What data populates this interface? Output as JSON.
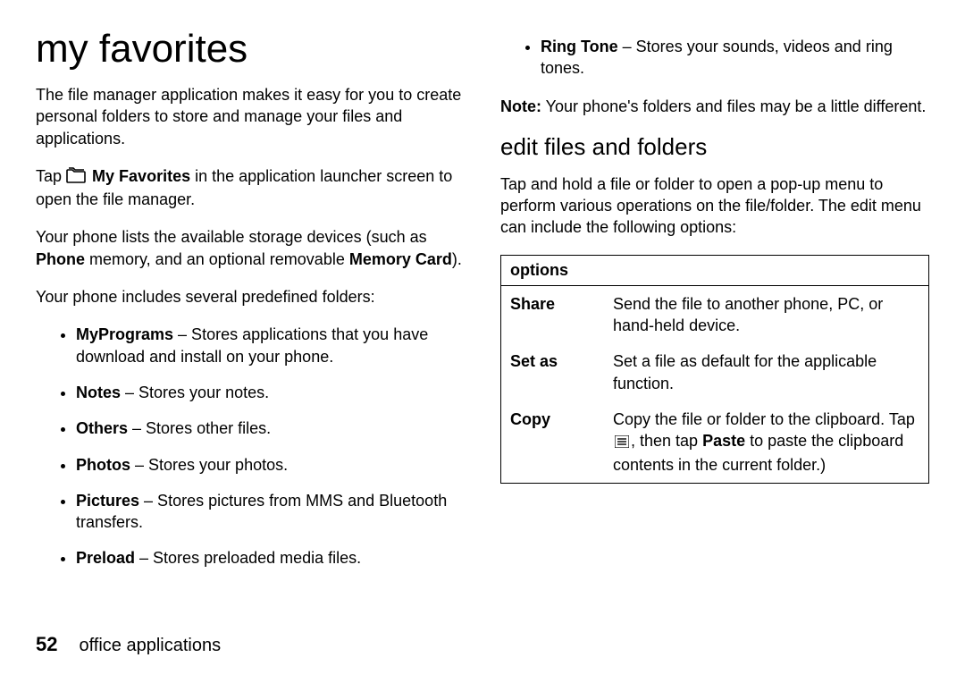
{
  "title": "my favorites",
  "intro": "The file manager application makes it easy for you to create personal folders to store and manage your files and applications.",
  "tap_prefix": "Tap ",
  "tap_title": "My Favorites",
  "tap_suffix": " in the application launcher screen to open the file manager.",
  "storage1": "Your phone lists the available storage devices (such as ",
  "storage_phone": "Phone",
  "storage_mid": " memory, and an optional removable ",
  "storage_card": "Memory Card",
  "storage_end": ").",
  "predef": "Your phone includes several predefined folders:",
  "folders": [
    {
      "name": "MyPrograms",
      "desc": " – Stores applications that you have download and install on your phone."
    },
    {
      "name": "Notes",
      "desc": " – Stores your notes."
    },
    {
      "name": "Others",
      "desc": " – Stores other files."
    },
    {
      "name": "Photos",
      "desc": " – Stores your photos."
    },
    {
      "name": "Pictures",
      "desc": " – Stores pictures from MMS and Bluetooth transfers."
    },
    {
      "name": "Preload",
      "desc": " – Stores preloaded media files."
    }
  ],
  "ringtone_name": "Ring Tone",
  "ringtone_desc": " – Stores your sounds, videos and ring tones.",
  "note_label": "Note:",
  "note_body": " Your phone's folders and files may be a little different.",
  "h2": "edit files and folders",
  "edit_p": "Tap and hold a file or folder to open a pop-up menu to perform various operations on the file/folder. The edit menu can include the following options:",
  "table_header": "options",
  "rows": [
    {
      "k": "Share",
      "v": "Send the file to another phone, PC, or hand-held device."
    },
    {
      "k": "Set as",
      "v": "Set a file as default for the applicable function."
    },
    {
      "k": "Copy",
      "v_pre": "Copy the file or folder to the clipboard. Tap ",
      "v_mid": ", then tap ",
      "v_paste": "Paste",
      "v_post": " to paste the clipboard contents in the current folder.)"
    }
  ],
  "page_num": "52",
  "section": "office applications"
}
